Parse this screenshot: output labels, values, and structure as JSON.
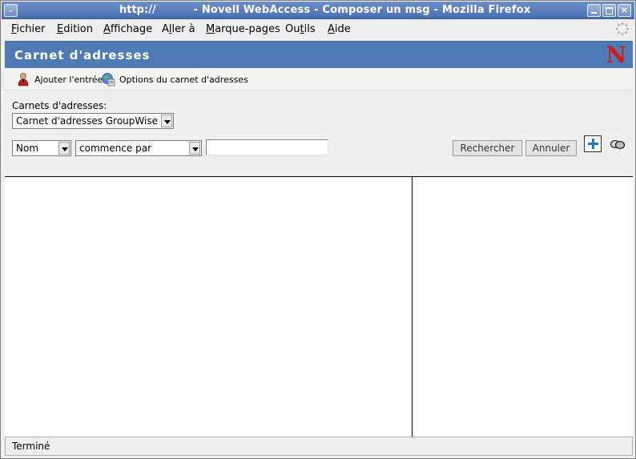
{
  "window": {
    "url": "http://",
    "title": "- Novell WebAccess - Composer un msg - Mozilla Firefox",
    "menu_icon": "chevron-down-icon",
    "min_icon": "minimize-icon",
    "max_icon": "maximize-icon",
    "close_label": "×"
  },
  "menubar": {
    "items": [
      {
        "key": "F",
        "rest": "ichier"
      },
      {
        "key": "E",
        "rest": "dition"
      },
      {
        "key": "A",
        "rest": "ffichage"
      },
      {
        "pre": "A",
        "key": "l",
        "rest": "ler à"
      },
      {
        "key": "M",
        "rest": "arque-pages"
      },
      {
        "pre": "Ou",
        "key": "t",
        "rest": "ils"
      },
      {
        "key": "A",
        "rest": "ide"
      }
    ]
  },
  "header": {
    "title": "Carnet d'adresses",
    "logo": "N",
    "background": "#4e7bb4",
    "logo_color": "#d11b1b"
  },
  "actions": {
    "add_entry": "Ajouter l'entrée",
    "options": "Options du carnet d'adresses"
  },
  "search": {
    "books_label": "Carnets d'adresses:",
    "book_selected": "Carnet d'adresses GroupWise",
    "field_selected": "Nom",
    "operator_selected": "commence par",
    "query_value": "",
    "search_button": "Rechercher",
    "cancel_button": "Annuler"
  },
  "status": {
    "text": "Terminé"
  }
}
